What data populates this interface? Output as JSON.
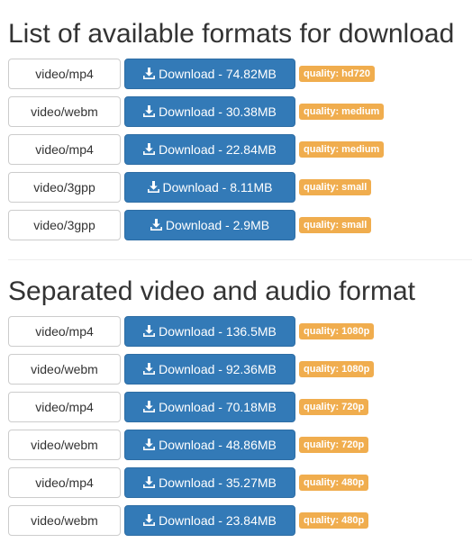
{
  "sections": [
    {
      "title": "List of available formats for download",
      "rows": [
        {
          "format": "video/mp4",
          "download": "Download - 74.82MB",
          "quality": "quality: hd720"
        },
        {
          "format": "video/webm",
          "download": "Download - 30.38MB",
          "quality": "quality: medium"
        },
        {
          "format": "video/mp4",
          "download": "Download - 22.84MB",
          "quality": "quality: medium"
        },
        {
          "format": "video/3gpp",
          "download": "Download - 8.11MB",
          "quality": "quality: small"
        },
        {
          "format": "video/3gpp",
          "download": "Download - 2.9MB",
          "quality": "quality: small"
        }
      ]
    },
    {
      "title": "Separated video and audio format",
      "rows": [
        {
          "format": "video/mp4",
          "download": "Download - 136.5MB",
          "quality": "quality: 1080p"
        },
        {
          "format": "video/webm",
          "download": "Download - 92.36MB",
          "quality": "quality: 1080p"
        },
        {
          "format": "video/mp4",
          "download": "Download - 70.18MB",
          "quality": "quality: 720p"
        },
        {
          "format": "video/webm",
          "download": "Download - 48.86MB",
          "quality": "quality: 720p"
        },
        {
          "format": "video/mp4",
          "download": "Download - 35.27MB",
          "quality": "quality: 480p"
        },
        {
          "format": "video/webm",
          "download": "Download - 23.84MB",
          "quality": "quality: 480p"
        }
      ]
    }
  ],
  "icons": {
    "download_button": "download-icon"
  },
  "colors": {
    "button_primary": "#337ab7",
    "button_border": "#2e6da4",
    "badge_warning": "#f0ad4e",
    "format_border": "#cccccc",
    "text": "#333333"
  }
}
